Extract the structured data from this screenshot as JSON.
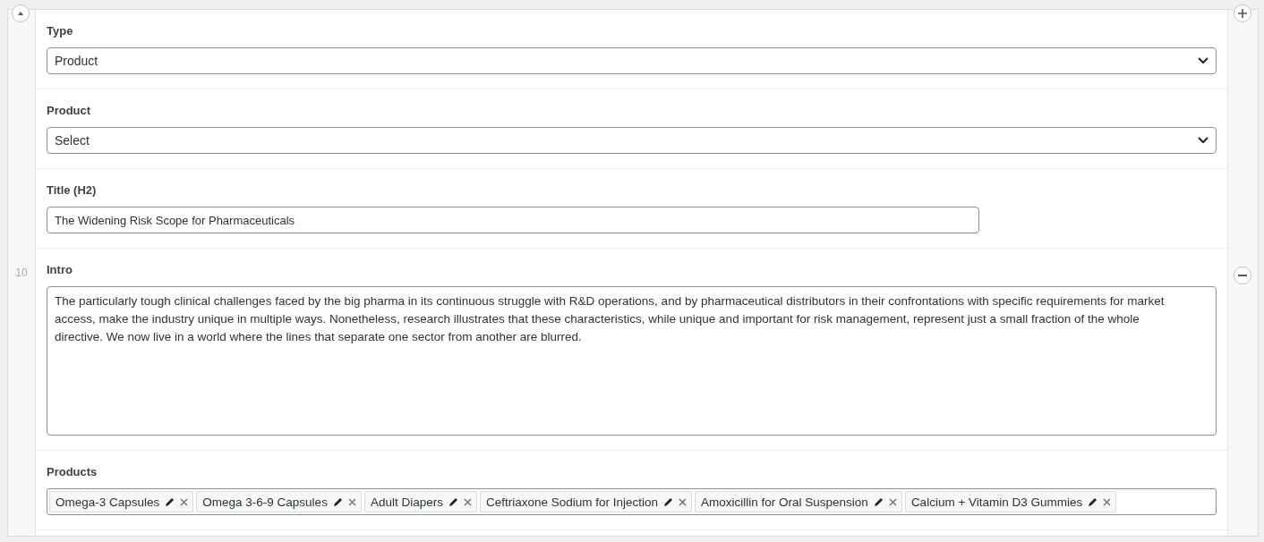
{
  "row": {
    "number": "10"
  },
  "fields": [
    {
      "kind": "select",
      "label": "Type",
      "value": "Product"
    },
    {
      "kind": "select",
      "label": "Product",
      "value": "Select"
    },
    {
      "kind": "text",
      "label": "Title (H2)",
      "value": "The Widening Risk Scope for Pharmaceuticals"
    },
    {
      "kind": "textarea",
      "label": "Intro",
      "value": "The particularly tough clinical challenges faced by the big pharma in its continuous struggle with R&D operations, and by pharmaceutical distributors in their confrontations with specific requirements for market access, make the industry unique in multiple ways. Nonetheless, research illustrates that these characteristics, while unique and important for risk management, represent just a small fraction of the whole directive. We now live in a world where the lines that separate one sector from another are blurred."
    },
    {
      "kind": "tags",
      "label": "Products",
      "tags": [
        "Omega-3 Capsules",
        "Omega 3-6-9 Capsules",
        "Adult Diapers",
        "Ceftriaxone Sodium for Injection",
        "Amoxicillin for Oral Suspension",
        "Calcium + Vitamin D3 Gummies"
      ]
    }
  ]
}
